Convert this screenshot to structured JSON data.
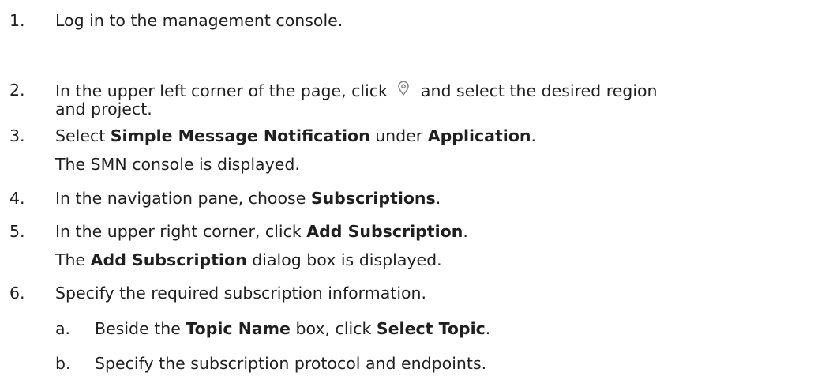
{
  "steps": [
    {
      "num": "1.",
      "text": "Log in to the management console."
    },
    {
      "num": "2.",
      "before_icon": "In the upper left corner of the page, click",
      "icon": "location-pin-icon",
      "after_icon": "and select the desired region",
      "line2": "and project."
    },
    {
      "num": "3.",
      "t1": "Select ",
      "b1": "Simple Message Notification",
      "t2": " under ",
      "b2": "Application",
      "t3": ".",
      "note": "The SMN console is displayed."
    },
    {
      "num": "4.",
      "t1": "In the navigation pane, choose ",
      "b1": "Subscriptions",
      "t2": "."
    },
    {
      "num": "5.",
      "t1": "In the upper right corner, click ",
      "b1": "Add Subscription",
      "t2": ".",
      "note_t1": "The ",
      "note_b1": "Add Subscription",
      "note_t2": " dialog box is displayed."
    },
    {
      "num": "6.",
      "text": "Specify the required subscription information."
    }
  ],
  "substeps": [
    {
      "num": "a.",
      "t1": "Beside the ",
      "b1": "Topic Name",
      "t2": " box, click ",
      "b2": "Select Topic",
      "t3": "."
    },
    {
      "num": "b.",
      "text": "Specify the subscription protocol and endpoints."
    }
  ]
}
